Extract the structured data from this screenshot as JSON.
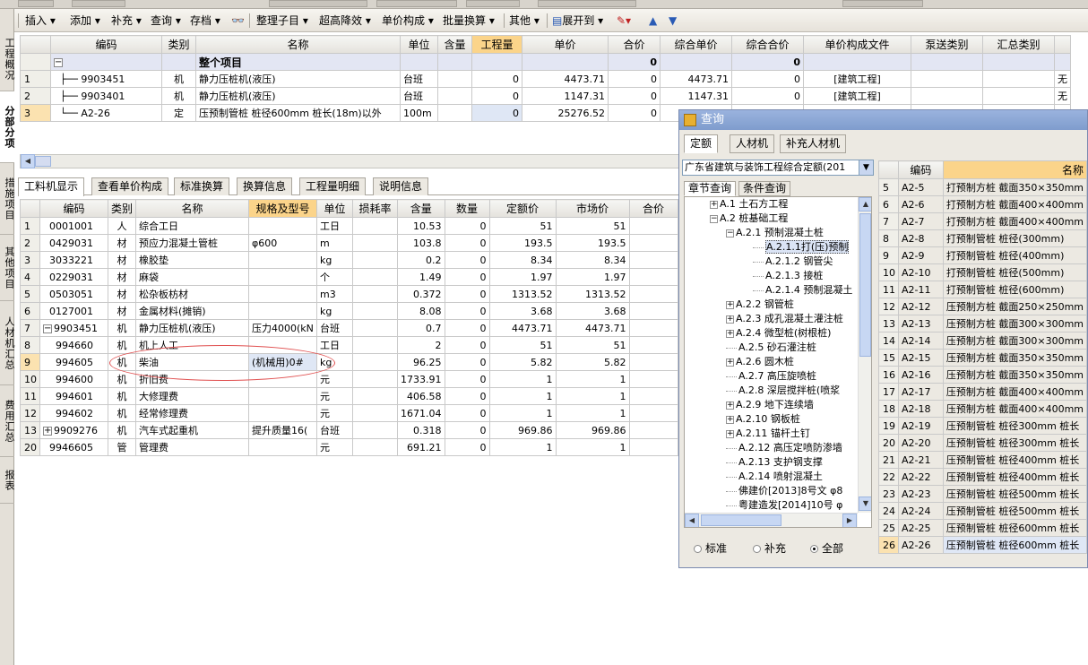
{
  "toolbar": {
    "items": [
      "插入",
      "添加",
      "补充",
      "查询",
      "存档",
      "整理子目",
      "超高降效",
      "单价构成",
      "批量换算",
      "其他",
      "展开到"
    ]
  },
  "left_tabs": [
    "工程概况",
    "分部分项",
    "措施项目",
    "其他项目",
    "人材机汇总",
    "费用汇总",
    "报表"
  ],
  "top_table": {
    "headers": [
      "编码",
      "类别",
      "名称",
      "单位",
      "含量",
      "工程量",
      "单价",
      "合价",
      "综合单价",
      "综合合价",
      "单价构成文件",
      "泵送类别",
      "汇总类别"
    ],
    "group_row": {
      "toggle": "−",
      "name": "整个项目",
      "total1": "0",
      "total2": "0"
    },
    "rows": [
      {
        "rn": "1",
        "code": "9903451",
        "type": "机",
        "name": "静力压桩机(液压)",
        "unit": "台班",
        "qty": "0",
        "price": "4473.71",
        "total": "0",
        "unit_total": "4473.71",
        "sum_total": "0",
        "file": "[建筑工程]",
        "tail": "无"
      },
      {
        "rn": "2",
        "code": "9903401",
        "type": "机",
        "name": "静力压桩机(液压)",
        "unit": "台班",
        "qty": "0",
        "price": "1147.31",
        "total": "0",
        "unit_total": "1147.31",
        "sum_total": "0",
        "file": "[建筑工程]",
        "tail": "无"
      },
      {
        "rn": "3",
        "code": "A2-26",
        "type": "定",
        "name": "压预制管桩 桩径600mm 桩长(18m)以外",
        "unit": "100m",
        "qty": "0",
        "price": "25276.52",
        "total": "0",
        "unit_total": "",
        "sum_total": "",
        "file": "",
        "tail": ""
      }
    ]
  },
  "bottom_tabs": [
    "工料机显示",
    "查看单价构成",
    "标准换算",
    "换算信息",
    "工程量明细",
    "说明信息"
  ],
  "bottom_table": {
    "headers": [
      "编码",
      "类别",
      "名称",
      "规格及型号",
      "单位",
      "损耗率",
      "含量",
      "数量",
      "定额价",
      "市场价",
      "合价"
    ],
    "rows": [
      {
        "rn": "1",
        "code": "0001001",
        "type": "人",
        "name": "综合工日",
        "spec": "",
        "unit": "工日",
        "qty": "10.53",
        "num": "0",
        "base": "51",
        "market": "51"
      },
      {
        "rn": "2",
        "code": "0429031",
        "type": "材",
        "name": "预应力混凝土管桩",
        "spec": "φ600",
        "unit": "m",
        "qty": "103.8",
        "num": "0",
        "base": "193.5",
        "market": "193.5"
      },
      {
        "rn": "3",
        "code": "3033221",
        "type": "材",
        "name": "橡胶垫",
        "spec": "",
        "unit": "kg",
        "qty": "0.2",
        "num": "0",
        "base": "8.34",
        "market": "8.34"
      },
      {
        "rn": "4",
        "code": "0229031",
        "type": "材",
        "name": "麻袋",
        "spec": "",
        "unit": "个",
        "qty": "1.49",
        "num": "0",
        "base": "1.97",
        "market": "1.97"
      },
      {
        "rn": "5",
        "code": "0503051",
        "type": "材",
        "name": "松杂板枋材",
        "spec": "",
        "unit": "m3",
        "qty": "0.372",
        "num": "0",
        "base": "1313.52",
        "market": "1313.52"
      },
      {
        "rn": "6",
        "code": "0127001",
        "type": "材",
        "name": "金属材料(摊销)",
        "spec": "",
        "unit": "kg",
        "qty": "8.08",
        "num": "0",
        "base": "3.68",
        "market": "3.68"
      },
      {
        "rn": "7",
        "code": "9903451",
        "type": "机",
        "name": "静力压桩机(液压)",
        "spec": "压力4000(kN",
        "unit": "台班",
        "qty": "0.7",
        "num": "0",
        "base": "4473.71",
        "market": "4473.71"
      },
      {
        "rn": "8",
        "code": "994660",
        "type": "机",
        "name": "机上人工",
        "spec": "",
        "unit": "工日",
        "qty": "2",
        "num": "0",
        "base": "51",
        "market": "51"
      },
      {
        "rn": "9",
        "code": "994605",
        "type": "机",
        "name": "柴油",
        "spec": "(机械用)0#",
        "unit": "kg",
        "qty": "96.25",
        "num": "0",
        "base": "5.82",
        "market": "5.82"
      },
      {
        "rn": "10",
        "code": "994600",
        "type": "机",
        "name": "折旧费",
        "spec": "",
        "unit": "元",
        "qty": "1733.91",
        "num": "0",
        "base": "1",
        "market": "1"
      },
      {
        "rn": "11",
        "code": "994601",
        "type": "机",
        "name": "大修理费",
        "spec": "",
        "unit": "元",
        "qty": "406.58",
        "num": "0",
        "base": "1",
        "market": "1"
      },
      {
        "rn": "12",
        "code": "994602",
        "type": "机",
        "name": "经常修理费",
        "spec": "",
        "unit": "元",
        "qty": "1671.04",
        "num": "0",
        "base": "1",
        "market": "1"
      },
      {
        "rn": "13",
        "code": "9909276",
        "type": "机",
        "name": "汽车式起重机",
        "spec": "提升质量16(",
        "unit": "台班",
        "qty": "0.318",
        "num": "0",
        "base": "969.86",
        "market": "969.86"
      },
      {
        "rn": "20",
        "code": "9946605",
        "type": "管",
        "name": "管理费",
        "spec": "",
        "unit": "元",
        "qty": "691.21",
        "num": "0",
        "base": "1",
        "market": "1"
      }
    ]
  },
  "dialog": {
    "title": "查询",
    "tabs": [
      "定额",
      "人材机",
      "补充人材机"
    ],
    "combo": "广东省建筑与装饰工程综合定额(201",
    "subtabs": [
      "章节查询",
      "条件查询"
    ],
    "tree": [
      {
        "box": "+",
        "label": "A.1 土石方工程",
        "level": 1
      },
      {
        "box": "−",
        "label": "A.2 桩基础工程",
        "level": 1
      },
      {
        "box": "−",
        "label": "A.2.1 预制混凝土桩",
        "level": 2
      },
      {
        "box": "",
        "label": "A.2.1.1打(压)预制",
        "level": 3
      },
      {
        "box": "",
        "label": "A.2.1.2 钢管尖",
        "level": 3
      },
      {
        "box": "",
        "label": "A.2.1.3 接桩",
        "level": 3
      },
      {
        "box": "",
        "label": "A.2.1.4 预制混凝土",
        "level": 3
      },
      {
        "box": "+",
        "label": "A.2.2 钢管桩",
        "level": 2
      },
      {
        "box": "+",
        "label": "A.2.3 成孔混凝土灌注桩",
        "level": 2
      },
      {
        "box": "+",
        "label": "A.2.4 微型桩(树根桩)",
        "level": 2
      },
      {
        "box": "",
        "label": "A.2.5 砂石灌注桩",
        "level": 2
      },
      {
        "box": "+",
        "label": "A.2.6 圆木桩",
        "level": 2
      },
      {
        "box": "",
        "label": "A.2.7 高压旋喷桩",
        "level": 2
      },
      {
        "box": "",
        "label": "A.2.8 深层搅拌桩(喷浆",
        "level": 2
      },
      {
        "box": "+",
        "label": "A.2.9 地下连续墙",
        "level": 2
      },
      {
        "box": "+",
        "label": "A.2.10 钢板桩",
        "level": 2
      },
      {
        "box": "+",
        "label": "A.2.11 锚杆土钉",
        "level": 2
      },
      {
        "box": "",
        "label": "A.2.12 高压定喷防渗墙",
        "level": 2
      },
      {
        "box": "",
        "label": "A.2.13 支护钢支撑",
        "level": 2
      },
      {
        "box": "",
        "label": "A.2.14 喷射混凝土",
        "level": 2
      },
      {
        "box": "",
        "label": "佛建价[2013]8号文 φ8",
        "level": 2
      },
      {
        "box": "",
        "label": "粤建造发[2014]10号 φ",
        "level": 2
      }
    ],
    "radios": [
      {
        "label": "标准",
        "on": false
      },
      {
        "label": "补充",
        "on": false
      },
      {
        "label": "全部",
        "on": true
      }
    ],
    "result_headers": [
      "编码",
      "名称"
    ],
    "results": [
      {
        "rn": "5",
        "code": "A2-5",
        "name": "打预制方桩 截面350×350mm"
      },
      {
        "rn": "6",
        "code": "A2-6",
        "name": "打预制方桩 截面400×400mm"
      },
      {
        "rn": "7",
        "code": "A2-7",
        "name": "打预制方桩 截面400×400mm"
      },
      {
        "rn": "8",
        "code": "A2-8",
        "name": "打预制管桩 桩径(300mm)"
      },
      {
        "rn": "9",
        "code": "A2-9",
        "name": "打预制管桩 桩径(400mm)"
      },
      {
        "rn": "10",
        "code": "A2-10",
        "name": "打预制管桩 桩径(500mm)"
      },
      {
        "rn": "11",
        "code": "A2-11",
        "name": "打预制管桩 桩径(600mm)"
      },
      {
        "rn": "12",
        "code": "A2-12",
        "name": "压预制方桩 截面250×250mm"
      },
      {
        "rn": "13",
        "code": "A2-13",
        "name": "压预制方桩 截面300×300mm"
      },
      {
        "rn": "14",
        "code": "A2-14",
        "name": "压预制方桩 截面300×300mm"
      },
      {
        "rn": "15",
        "code": "A2-15",
        "name": "压预制方桩 截面350×350mm"
      },
      {
        "rn": "16",
        "code": "A2-16",
        "name": "压预制方桩 截面350×350mm"
      },
      {
        "rn": "17",
        "code": "A2-17",
        "name": "压预制方桩 截面400×400mm"
      },
      {
        "rn": "18",
        "code": "A2-18",
        "name": "压预制方桩 截面400×400mm"
      },
      {
        "rn": "19",
        "code": "A2-19",
        "name": "压预制管桩 桩径300mm 桩长"
      },
      {
        "rn": "20",
        "code": "A2-20",
        "name": "压预制管桩 桩径300mm 桩长"
      },
      {
        "rn": "21",
        "code": "A2-21",
        "name": "压预制管桩 桩径400mm 桩长"
      },
      {
        "rn": "22",
        "code": "A2-22",
        "name": "压预制管桩 桩径400mm 桩长"
      },
      {
        "rn": "23",
        "code": "A2-23",
        "name": "压预制管桩 桩径500mm 桩长"
      },
      {
        "rn": "24",
        "code": "A2-24",
        "name": "压预制管桩 桩径500mm 桩长"
      },
      {
        "rn": "25",
        "code": "A2-25",
        "name": "压预制管桩 桩径600mm 桩长"
      },
      {
        "rn": "26",
        "code": "A2-26",
        "name": "压预制管桩 桩径600mm 桩长"
      }
    ]
  },
  "colors": {
    "header_highlight": "#fbd48a",
    "dialog_title": "#7f9ccd",
    "ellipse": "#e05050"
  }
}
